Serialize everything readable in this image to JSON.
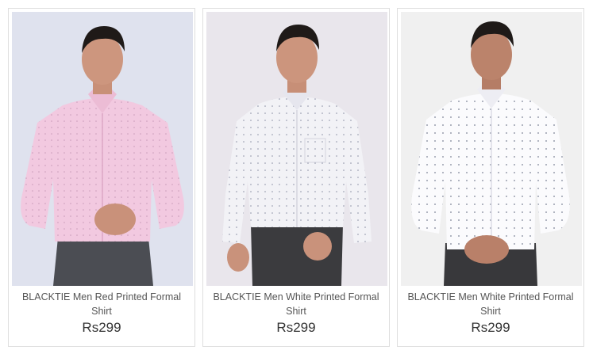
{
  "products": [
    {
      "image_alt": "Model wearing pink printed formal shirt",
      "title": "BLACKTIE Men Red Printed Formal Shirt",
      "price": "Rs299",
      "shirt_color": "#f2c9e0",
      "bg_color": "#dfe2ee"
    },
    {
      "image_alt": "Model wearing white printed formal shirt",
      "title": "BLACKTIE Men White Printed Formal Shirt",
      "price": "Rs299",
      "shirt_color": "#f2f2f6",
      "bg_color": "#e9e6ec"
    },
    {
      "image_alt": "Model wearing white printed formal shirt",
      "title": "BLACKTIE Men White Printed Formal Shirt",
      "price": "Rs299",
      "shirt_color": "#fbfbfd",
      "bg_color": "#f0f0f0"
    }
  ]
}
